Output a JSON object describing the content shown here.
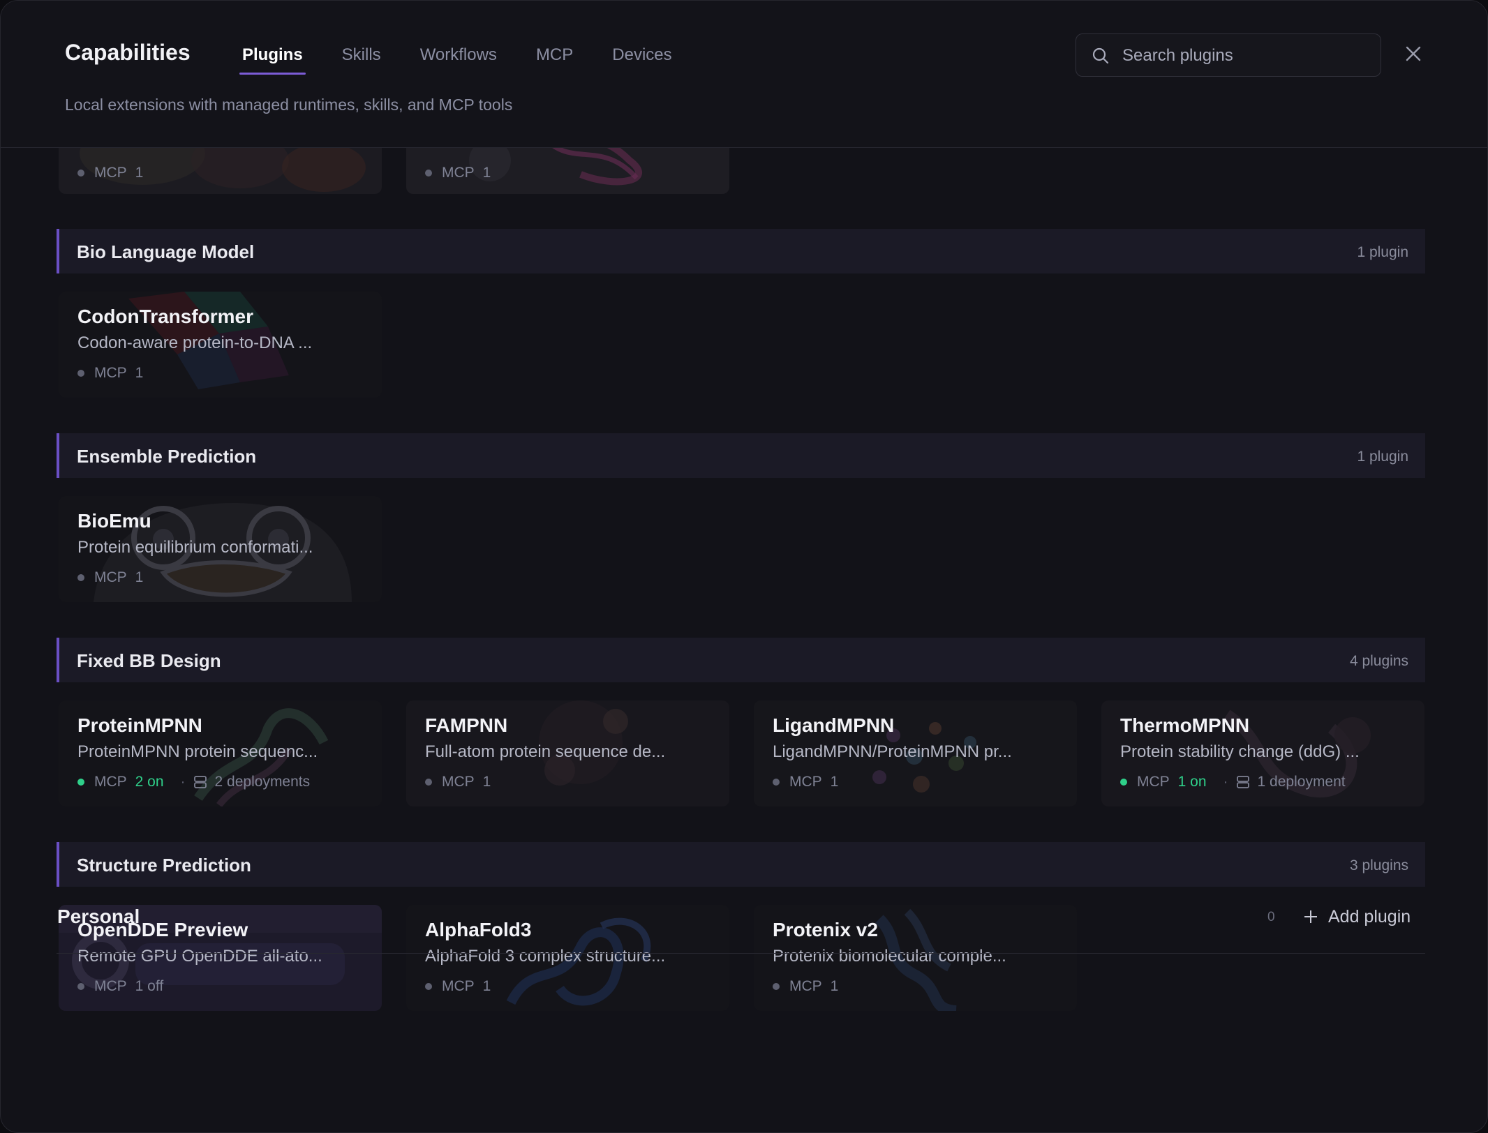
{
  "header": {
    "title": "Capabilities",
    "subtitle": "Local extensions with managed runtimes, skills, and MCP tools",
    "tabs": [
      {
        "label": "Plugins",
        "active": true
      },
      {
        "label": "Skills",
        "active": false
      },
      {
        "label": "Workflows",
        "active": false
      },
      {
        "label": "MCP",
        "active": false
      },
      {
        "label": "Devices",
        "active": false
      }
    ],
    "search": {
      "placeholder": "Search plugins",
      "value": ""
    },
    "close_icon": "close-icon"
  },
  "partial_cards": [
    {
      "meta_label": "MCP",
      "meta_count": "1"
    },
    {
      "meta_label": "MCP",
      "meta_count": "1"
    }
  ],
  "sections": [
    {
      "title": "Bio Language Model",
      "count": "1 plugin",
      "cards": [
        {
          "name": "CodonTransformer",
          "desc": "Codon-aware protein-to-DNA ...",
          "meta_label": "MCP",
          "meta_count": "1"
        }
      ]
    },
    {
      "title": "Ensemble Prediction",
      "count": "1 plugin",
      "cards": [
        {
          "name": "BioEmu",
          "desc": "Protein equilibrium conformati...",
          "meta_label": "MCP",
          "meta_count": "1"
        }
      ]
    },
    {
      "title": "Fixed BB Design",
      "count": "4 plugins",
      "cards": [
        {
          "name": "ProteinMPNN",
          "desc": "ProteinMPNN protein sequenc...",
          "meta_label": "MCP",
          "meta_on": "2 on",
          "deployments": "2 deployments"
        },
        {
          "name": "FAMPNN",
          "desc": "Full-atom protein sequence de...",
          "meta_label": "MCP",
          "meta_count": "1"
        },
        {
          "name": "LigandMPNN",
          "desc": "LigandMPNN/ProteinMPNN pr...",
          "meta_label": "MCP",
          "meta_count": "1"
        },
        {
          "name": "ThermoMPNN",
          "desc": "Protein stability change (ddG) ...",
          "meta_label": "MCP",
          "meta_on": "1 on",
          "deployments": "1 deployment"
        }
      ]
    },
    {
      "title": "Structure Prediction",
      "count": "3 plugins",
      "cards": [
        {
          "name": "OpenDDE Preview",
          "desc": "Remote GPU OpenDDE all-ato...",
          "meta_label": "MCP",
          "meta_count": "1 off"
        },
        {
          "name": "AlphaFold3",
          "desc": "AlphaFold 3 complex structure...",
          "meta_label": "MCP",
          "meta_count": "1"
        },
        {
          "name": "Protenix v2",
          "desc": "Protenix biomolecular comple...",
          "meta_label": "MCP",
          "meta_count": "1"
        }
      ]
    }
  ],
  "personal": {
    "title": "Personal",
    "count": "0",
    "add_label": "Add plugin"
  },
  "colors": {
    "accent": "#7c5cd6",
    "status_on": "#2fd08a",
    "background": "#121218",
    "section_bg": "#1b1a26"
  }
}
